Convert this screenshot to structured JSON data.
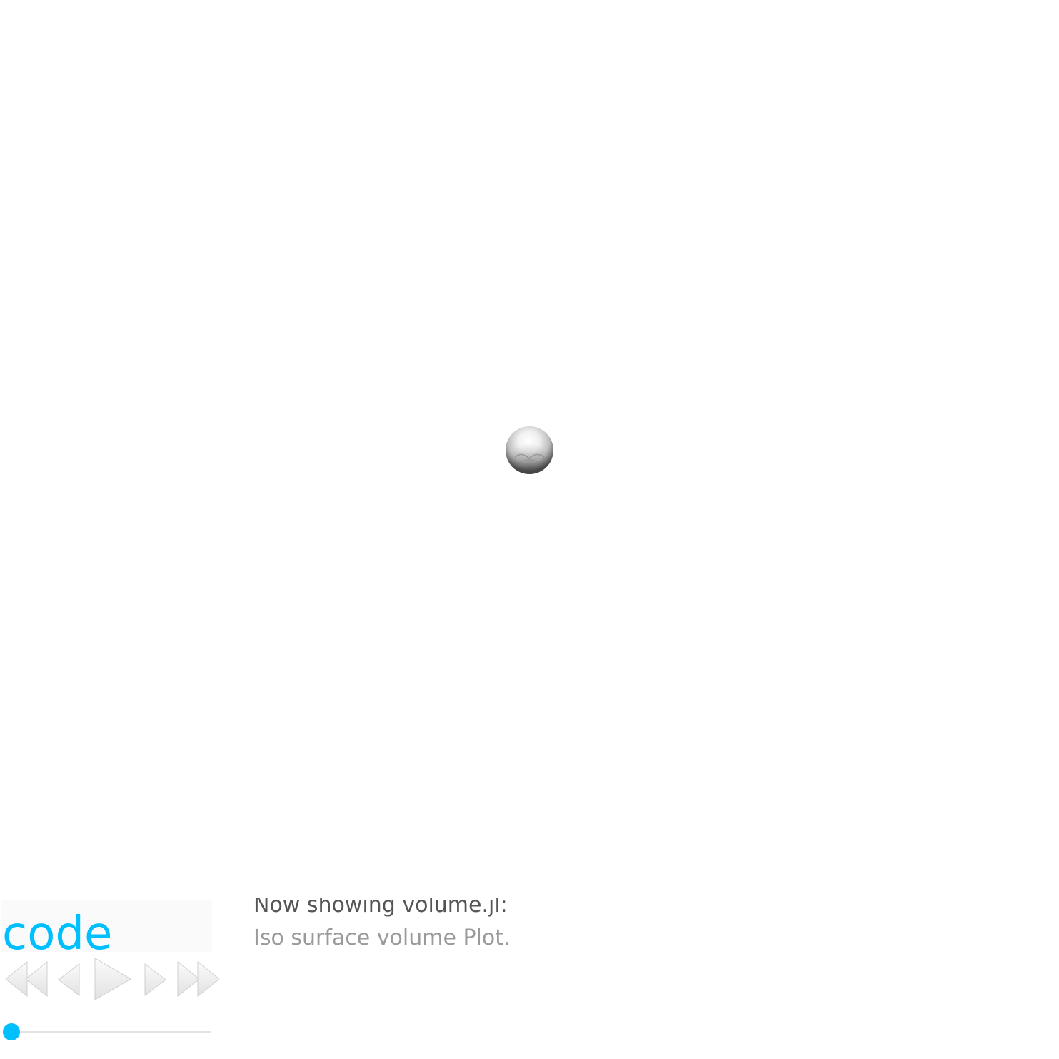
{
  "viewer": {
    "object": "iso-surface-sphere",
    "background": "#ffffff"
  },
  "panel": {
    "code_label": "code",
    "accent_color": "#00bfff",
    "controls": {
      "first_icon": "rewind-to-start-icon",
      "prev_icon": "step-back-icon",
      "play_icon": "play-icon",
      "next_icon": "step-forward-icon",
      "last_icon": "fast-forward-to-end-icon"
    },
    "slider": {
      "value": 0
    }
  },
  "info": {
    "now_showing": "Now showing volume.jl:",
    "description": "Iso surface volume Plot."
  }
}
